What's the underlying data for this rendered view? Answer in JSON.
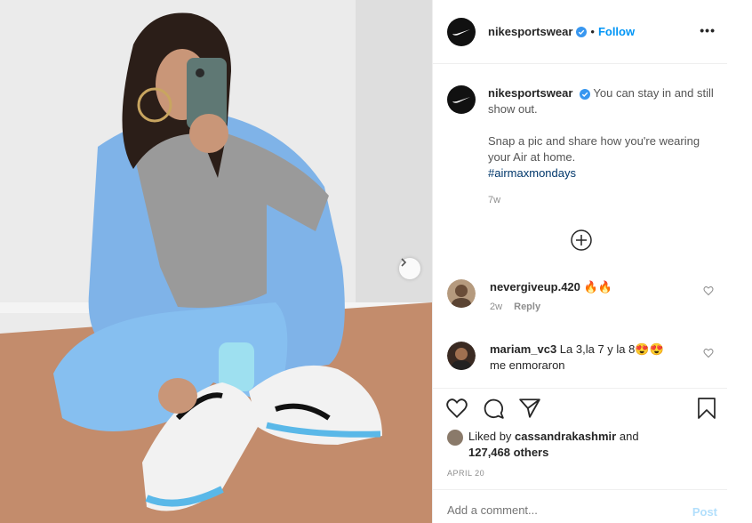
{
  "post": {
    "account": "nikesportswear",
    "follow_label": "Follow",
    "dot": "•",
    "more_label": "•••",
    "caption": {
      "username": "nikesportswear",
      "line1": "You can stay in and still show out.",
      "line2": "Snap a pic and share how you're wearing your Air at home.",
      "hashtag": "#airmaxmondays",
      "age": "7w"
    },
    "comments": [
      {
        "username": "nevergiveup.420",
        "text": "🔥🔥",
        "age": "2w",
        "reply_label": "Reply"
      },
      {
        "username": "mariam_vc3",
        "text": "La 3,la 7 y la 8😍😍 me enmoraron"
      }
    ],
    "likes": {
      "prefix": "Liked by",
      "user": "cassandrakashmir",
      "and": "and",
      "count": "127,468 others"
    },
    "date": "APRIL 20",
    "add_comment_placeholder": "Add a comment...",
    "post_label": "Post"
  },
  "colors": {
    "link_blue": "#0095f6",
    "hashtag": "#00376b",
    "muted": "#8e8e8e",
    "jacket_blue": "#7fb3e8"
  },
  "icons": [
    "nike-logo-icon",
    "verified-badge-icon",
    "more-options-icon",
    "next-arrow-icon",
    "add-circle-icon",
    "heart-icon",
    "comment-icon",
    "share-icon",
    "bookmark-icon"
  ]
}
